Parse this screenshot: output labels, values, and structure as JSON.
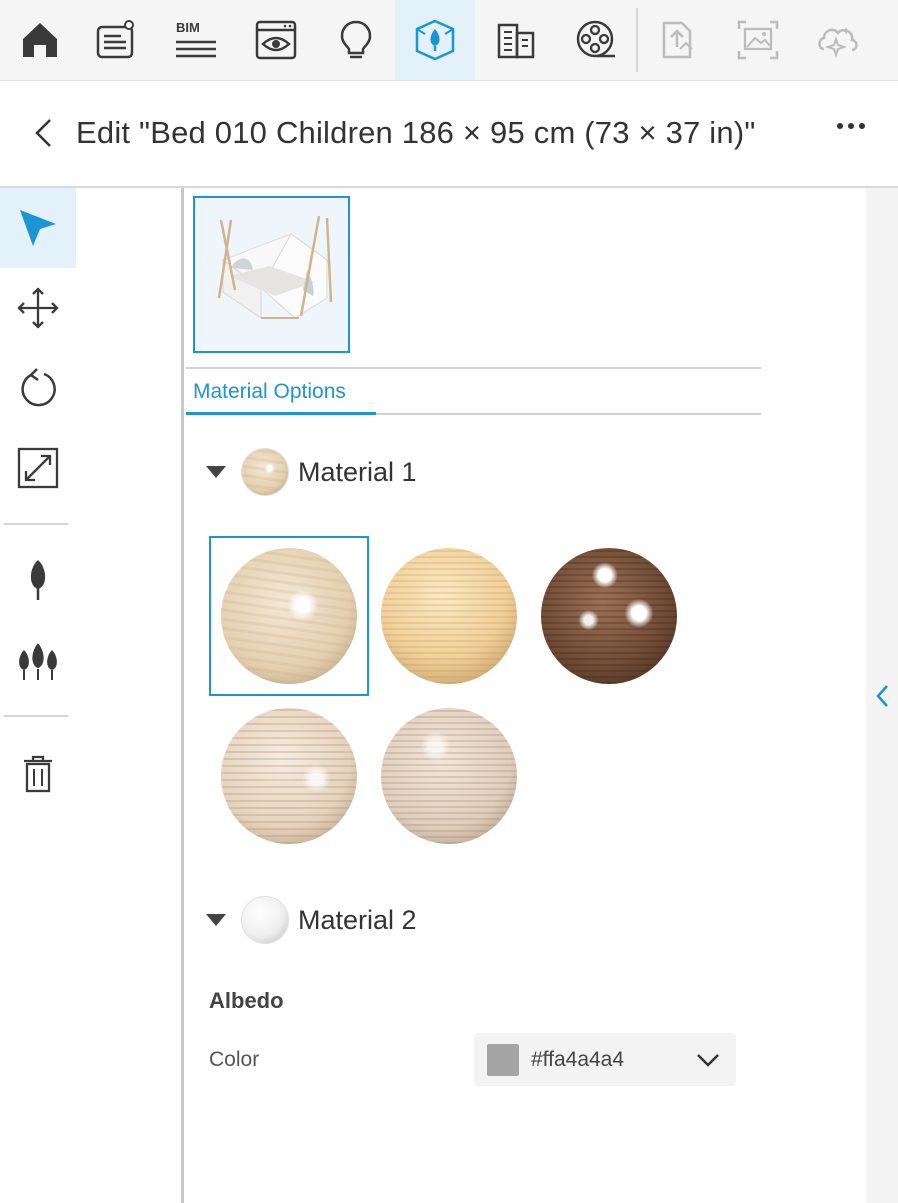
{
  "toolbar": {
    "items": [
      {
        "name": "home-icon",
        "active": false
      },
      {
        "name": "notes-icon",
        "active": false
      },
      {
        "name": "bim-icon",
        "label": "BIM",
        "active": false
      },
      {
        "name": "view-icon",
        "active": false
      },
      {
        "name": "lightbulb-icon",
        "active": false
      },
      {
        "name": "tree-cube-icon",
        "active": true
      },
      {
        "name": "building-icon",
        "active": false
      },
      {
        "name": "film-reel-icon",
        "active": false
      },
      {
        "name": "export-icon",
        "disabled": true
      },
      {
        "name": "image-render-icon",
        "disabled": true
      },
      {
        "name": "ai-sparkle-icon",
        "disabled": true
      }
    ]
  },
  "header": {
    "title": "Edit \"Bed 010 Children 186 × 95 cm (73 × 37 in)\"",
    "back_icon": "chevron-left-icon",
    "more_icon": "more-icon"
  },
  "tools": [
    {
      "name": "select-arrow-icon",
      "active": true
    },
    {
      "name": "move-icon"
    },
    {
      "name": "rotate-icon"
    },
    {
      "name": "scale-icon"
    },
    {
      "name": "tree-icon"
    },
    {
      "name": "trees-icon"
    },
    {
      "name": "trash-icon"
    }
  ],
  "tabs": {
    "active": "Material Options"
  },
  "materials": [
    {
      "label": "Material 1",
      "expanded": true,
      "swatches": [
        "light-oak",
        "natural-pine",
        "dark-walnut",
        "white-ash",
        "bleached-oak"
      ],
      "selected_index": 0
    },
    {
      "label": "Material 2",
      "expanded": true,
      "albedo_heading": "Albedo",
      "color_label": "Color",
      "color_value": "#ffa4a4a4"
    }
  ],
  "colors": {
    "accent": "#1b95d3",
    "albedo_swatch": "#a4a4a4"
  }
}
